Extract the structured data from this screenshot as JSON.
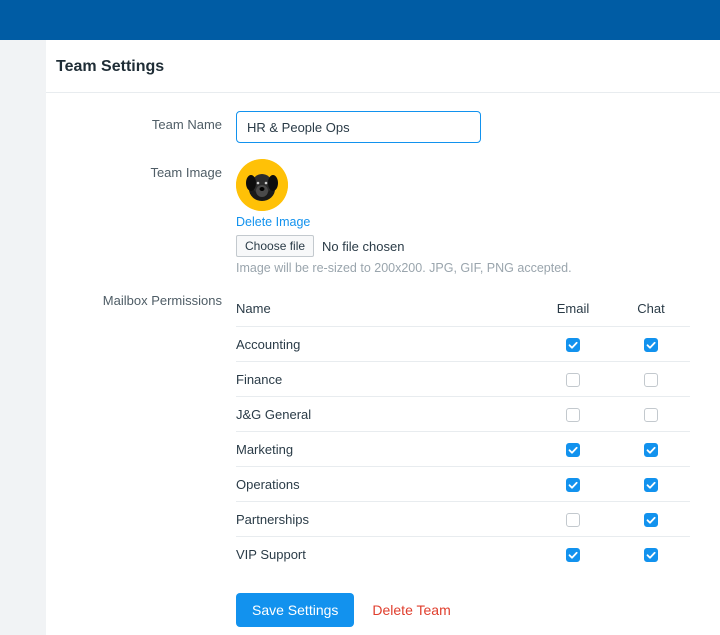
{
  "header": {
    "title": "Team Settings"
  },
  "form": {
    "team_name": {
      "label": "Team Name",
      "value": "HR & People Ops"
    },
    "team_image": {
      "label": "Team Image",
      "delete_link": "Delete Image",
      "choose_button": "Choose file",
      "file_status": "No file chosen",
      "hint": "Image will be re-sized to 200x200. JPG, GIF, PNG accepted."
    },
    "permissions": {
      "label": "Mailbox Permissions",
      "columns": {
        "name": "Name",
        "email": "Email",
        "chat": "Chat"
      },
      "rows": [
        {
          "name": "Accounting",
          "email": true,
          "chat": true
        },
        {
          "name": "Finance",
          "email": false,
          "chat": false
        },
        {
          "name": "J&G General",
          "email": false,
          "chat": false
        },
        {
          "name": "Marketing",
          "email": true,
          "chat": true
        },
        {
          "name": "Operations",
          "email": true,
          "chat": true
        },
        {
          "name": "Partnerships",
          "email": false,
          "chat": true
        },
        {
          "name": "VIP Support",
          "email": true,
          "chat": true
        }
      ]
    },
    "actions": {
      "save": "Save Settings",
      "delete": "Delete Team"
    }
  }
}
